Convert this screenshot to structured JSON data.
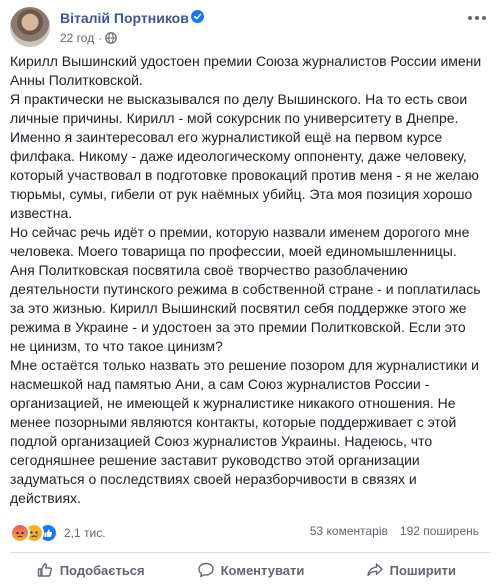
{
  "post": {
    "author": "Віталій Портников",
    "timestamp": "22 год",
    "privacy_icon": "globe-icon",
    "verified_icon": "verified-badge-icon",
    "paragraphs": [
      "Кирилл Вышинский удостоен премии Союза журналистов России имени Анны Политковской.",
      "Я практически не высказывался по делу Вышинского. На то есть свои личные причины. Кирилл - мой сокурсник по университету в Днепре. Именно я заинтересовал его журналистикой ещё на первом курсе филфака. Никому - даже идеологическому оппоненту, даже человеку, который участвовал в подготовке провокаций против меня - я не желаю тюрьмы, сумы, гибели от рук наёмных убийц. Эта моя позиция хорошо известна.",
      "Но сейчас речь идёт о премии, которую назвали именем дорогого мне человека. Моего товарища по профессии, моей единомышленницы. Аня Политковская посвятила своё творчество разоблачению деятельности путинского режима в собственной стране - и поплатилась за это жизнью. Кирилл Вышинский посвятил себя поддержке этого же режима в Украине - и удостоен за это премии Политковской. Если это не цинизм, то что такое цинизм?",
      "Мне остаётся только назвать это решение позором для журналистики и насмешкой над памятью Ани, а сам Союз журналистов России - организацией, не имеющей к журналистике никакого отношения. Не менее позорными являются контакты, которые поддерживает с этой подлой организацией Союз журналистов Украины. Надеюсь, что сегодняшнее решение заставит руководство этой организации задуматься о последствиях своей неразборчивости в связях и действиях."
    ]
  },
  "stats": {
    "reaction_icons": [
      "angry-reaction-icon",
      "sad-reaction-icon",
      "like-reaction-icon"
    ],
    "reactions_count": "2,1 тис.",
    "comments": "53 коментарів",
    "shares": "192 поширень"
  },
  "actions": {
    "like": "Подобається",
    "comment": "Коментувати",
    "share": "Поширити"
  },
  "colors": {
    "author": "#385898",
    "text": "#1d2129",
    "muted": "#606770",
    "verified": "#1877f2"
  }
}
